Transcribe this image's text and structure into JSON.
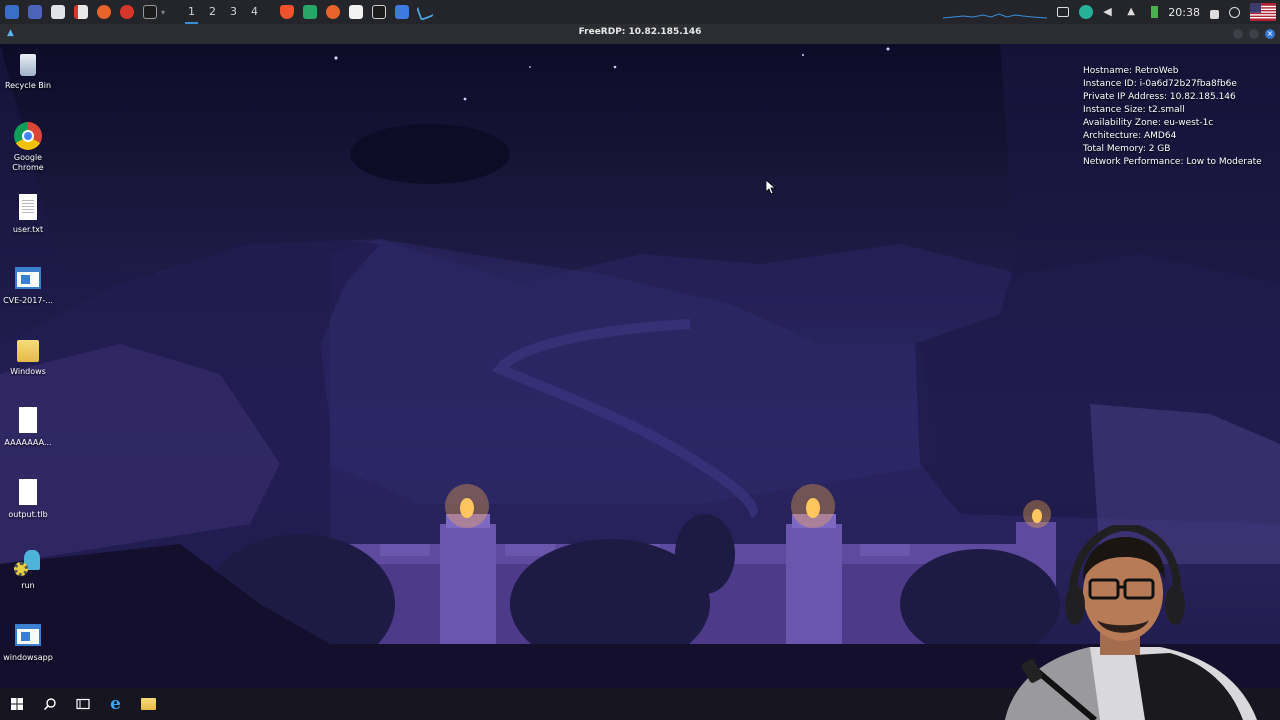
{
  "host_panel": {
    "workspaces": [
      "1",
      "2",
      "3",
      "4"
    ],
    "active_workspace": "1",
    "clock": "20:38",
    "apps": [
      "kali-menu-icon",
      "desktop-icon",
      "file-manager-icon",
      "text-editor-icon",
      "firefox-icon",
      "burp-icon",
      "terminal-icon",
      "brave-icon",
      "notes-icon",
      "firefox-icon",
      "document-icon",
      "terminal-icon",
      "screenshot-icon",
      "kali-dragon-icon"
    ]
  },
  "rdp_window": {
    "title": "FreeRDP: 10.82.185.146"
  },
  "desktop_icons": [
    {
      "name": "recycle-bin",
      "label": "Recycle Bin",
      "icon": "recycle-bin-icon"
    },
    {
      "name": "google-chrome",
      "label": "Google Chrome",
      "icon": "chrome-icon"
    },
    {
      "name": "user-txt",
      "label": "user.txt",
      "icon": "text-file-icon"
    },
    {
      "name": "cve-file",
      "label": "CVE-2017-...",
      "icon": "application-icon"
    },
    {
      "name": "windows-folder",
      "label": "Windows",
      "icon": "folder-icon"
    },
    {
      "name": "aaaaaa-file",
      "label": "AAAAAAA...",
      "icon": "blank-file-icon"
    },
    {
      "name": "output-tlb",
      "label": "output.tlb",
      "icon": "blank-file-icon"
    },
    {
      "name": "run",
      "label": "run",
      "icon": "gear-script-icon"
    },
    {
      "name": "windowsapp",
      "label": "windowsapp",
      "icon": "application-icon"
    }
  ],
  "bginfo": [
    "Hostname: RetroWeb",
    "Instance ID: i-0a6d72b27fba8fb6e",
    "Private IP Address: 10.82.185.146",
    "Instance Size: t2.small",
    "Availability Zone: eu-west-1c",
    "Architecture: AMD64",
    "Total Memory: 2 GB",
    "Network Performance: Low to Moderate"
  ],
  "taskbar": {
    "items": [
      "start-icon",
      "search-icon",
      "task-view-icon",
      "internet-explorer-icon",
      "file-explorer-icon"
    ]
  },
  "colors": {
    "host_panel_bg": "#23252b",
    "desktop_top": "#0d0c27",
    "desktop_mid": "#282361",
    "torch_flame": "#ffd06a",
    "taskbar_bg": "#17151f"
  }
}
